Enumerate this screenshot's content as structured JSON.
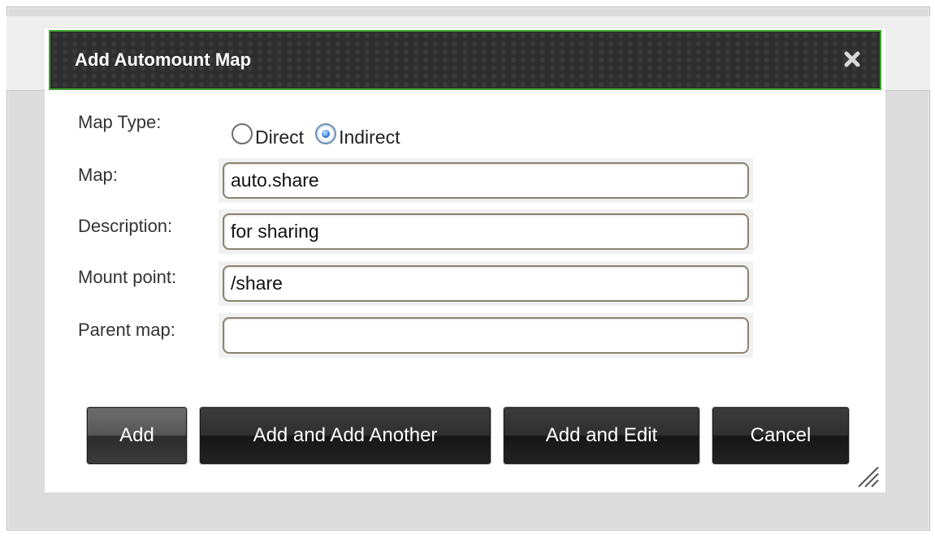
{
  "dialog": {
    "title": "Add Automount Map",
    "close_icon": "close-icon"
  },
  "form": {
    "map_type": {
      "label": "Map Type:",
      "options": [
        {
          "label": "Direct",
          "checked": false
        },
        {
          "label": "Indirect",
          "checked": true
        }
      ]
    },
    "map": {
      "label": "Map:",
      "value": "auto.share"
    },
    "description": {
      "label": "Description:",
      "value": "for sharing"
    },
    "mount_point": {
      "label": "Mount point:",
      "value": "/share"
    },
    "parent_map": {
      "label": "Parent map:",
      "value": ""
    }
  },
  "buttons": {
    "add": "Add",
    "add_another": "Add and Add Another",
    "add_edit": "Add and Edit",
    "cancel": "Cancel"
  },
  "icons": {
    "resize": "resize-grip-icon"
  },
  "colors": {
    "titlebar_border": "#3fa52e",
    "titlebar_bg": "#2e2e2e",
    "radio_checked": "#2f7bd3"
  }
}
